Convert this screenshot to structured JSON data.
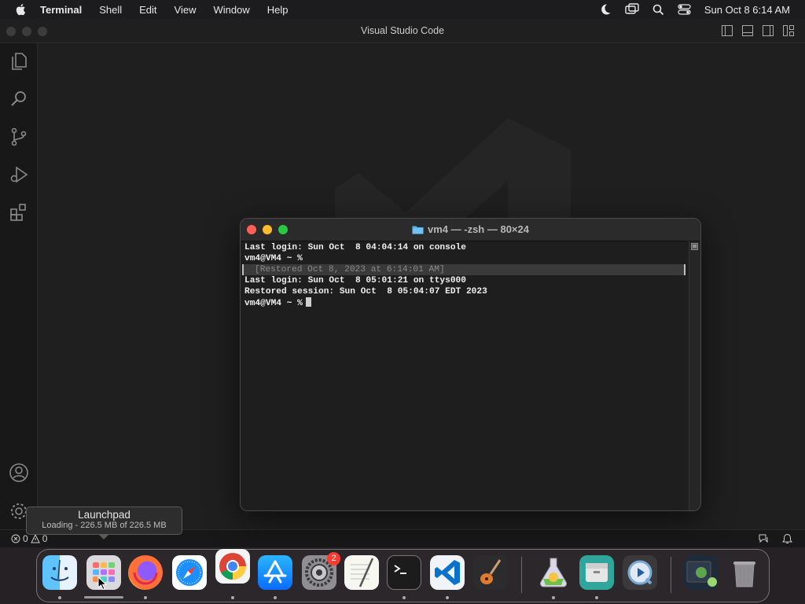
{
  "menubar": {
    "app_name": "Terminal",
    "items": [
      "Shell",
      "Edit",
      "View",
      "Window",
      "Help"
    ],
    "clock": "Sun Oct 8  6:14 AM"
  },
  "vscode": {
    "window_title": "Visual Studio Code",
    "status": {
      "errors": "0",
      "warnings": "0"
    }
  },
  "terminal": {
    "title": "vm4 — -zsh — 80×24",
    "lines": [
      "Last login: Sun Oct  8 04:04:14 on console",
      "vm4@VM4 ~ %",
      "[Restored Oct 8, 2023 at 6:14:01 AM]",
      "Last login: Sun Oct  8 05:01:21 on ttys000",
      "Restored session: Sun Oct  8 05:04:07 EDT 2023",
      "vm4@VM4 ~ %"
    ]
  },
  "tooltip": {
    "title": "Launchpad",
    "subtitle": "Loading - 226.5 MB of 226.5 MB"
  },
  "dock": {
    "items": [
      {
        "name": "Finder",
        "icon": "finder-icon"
      },
      {
        "name": "Launchpad",
        "icon": "launchpad-icon"
      },
      {
        "name": "Firefox",
        "icon": "firefox-icon"
      },
      {
        "name": "Safari",
        "icon": "safari-icon"
      },
      {
        "name": "Google Chrome",
        "icon": "chrome-icon"
      },
      {
        "name": "App Store",
        "icon": "app-store-icon"
      },
      {
        "name": "System Settings",
        "icon": "system-settings-icon",
        "badge": "2"
      },
      {
        "name": "TextEdit",
        "icon": "textedit-icon"
      },
      {
        "name": "Terminal",
        "icon": "terminal-icon"
      },
      {
        "name": "Visual Studio Code",
        "icon": "vscode-icon"
      },
      {
        "name": "GarageBand",
        "icon": "garageband-icon"
      },
      {
        "name": "Python Launcher",
        "icon": "python-launcher-icon"
      },
      {
        "name": "Archive Utility",
        "icon": "archive-icon"
      },
      {
        "name": "QuickTime Player",
        "icon": "quicktime-icon"
      },
      {
        "name": "Downloads",
        "icon": "downloads-stack-icon"
      },
      {
        "name": "Trash",
        "icon": "trash-icon"
      }
    ]
  },
  "colors": {
    "close": "#ff5f57",
    "minimize": "#febc2e",
    "zoom": "#28c840",
    "badge": "#ff3b30"
  }
}
